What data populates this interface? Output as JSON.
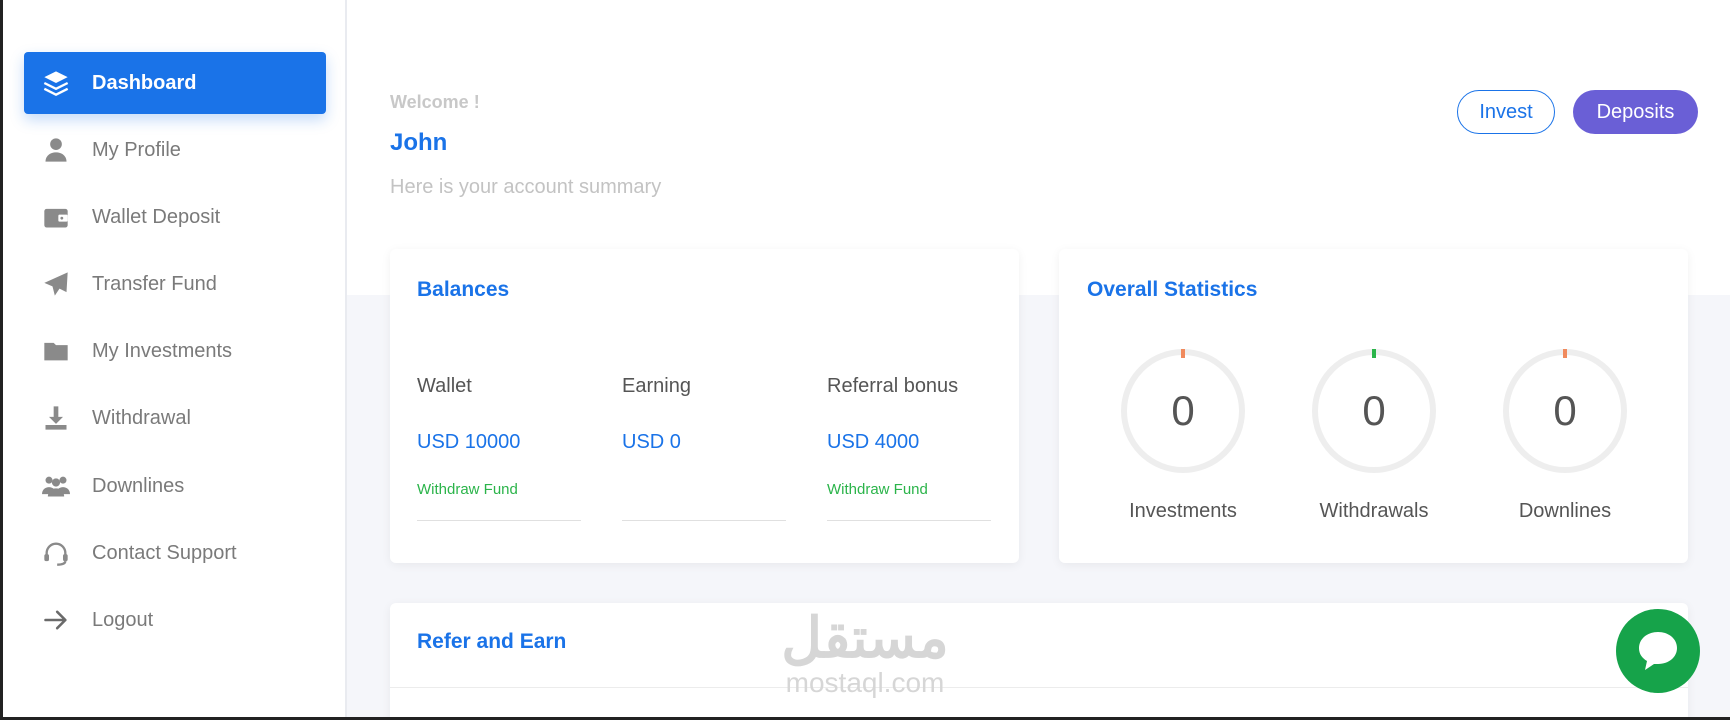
{
  "sidebar": {
    "items": [
      {
        "label": "Dashboard",
        "icon": "layers-icon",
        "active": true
      },
      {
        "label": "My Profile",
        "icon": "user-icon"
      },
      {
        "label": "Wallet Deposit",
        "icon": "wallet-icon"
      },
      {
        "label": "Transfer Fund",
        "icon": "paper-plane-icon"
      },
      {
        "label": "My Investments",
        "icon": "folder-icon"
      },
      {
        "label": "Withdrawal",
        "icon": "download-icon"
      },
      {
        "label": "Downlines",
        "icon": "users-icon"
      },
      {
        "label": "Contact Support",
        "icon": "headset-icon"
      },
      {
        "label": "Logout",
        "icon": "arrow-right-icon"
      }
    ]
  },
  "header": {
    "welcome": "Welcome !",
    "username": "John",
    "summary": "Here is your account summary",
    "invest_label": "Invest",
    "deposits_label": "Deposits"
  },
  "balances": {
    "title": "Balances",
    "columns": [
      {
        "label": "Wallet",
        "value": "USD 10000",
        "link": "Withdraw Fund"
      },
      {
        "label": "Earning",
        "value": "USD 0",
        "link": ""
      },
      {
        "label": "Referral bonus",
        "value": "USD 4000",
        "link": "Withdraw Fund"
      }
    ]
  },
  "statistics": {
    "title": "Overall Statistics",
    "items": [
      {
        "label": "Investments",
        "value": "0",
        "marker_color": "#f08a5d"
      },
      {
        "label": "Withdrawals",
        "value": "0",
        "marker_color": "#2bb44a"
      },
      {
        "label": "Downlines",
        "value": "0",
        "marker_color": "#f08a5d"
      }
    ]
  },
  "refer": {
    "title": "Refer and Earn"
  },
  "watermark": {
    "arabic": "مستقل",
    "latin": "mostaql.com"
  },
  "colors": {
    "primary": "#1a73e8",
    "deposits": "#6a5fd6",
    "chat": "#16a34a",
    "success": "#2bb44a"
  }
}
